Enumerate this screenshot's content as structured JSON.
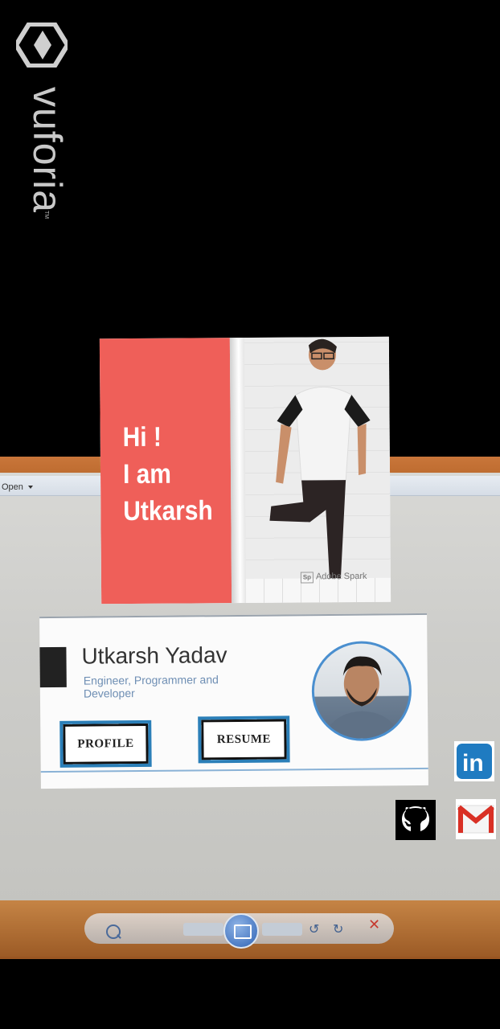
{
  "watermark": {
    "brand": "vuforia",
    "trademark": "TM"
  },
  "background_viewer": {
    "menu_label": "Open"
  },
  "intro_card": {
    "greeting_lines": [
      "Hi !",
      "I am",
      "Utkarsh"
    ],
    "watermark_badge": "Sp",
    "watermark_text": "Adobe Spark"
  },
  "profile_card": {
    "name": "Utkarsh Yadav",
    "subtitle": "Engineer, Programmer and Developer",
    "profile_button": "PROFILE",
    "resume_button": "RESUME"
  },
  "social": {
    "linkedin": "in",
    "icons": [
      "linkedin-icon",
      "github-icon",
      "gmail-icon"
    ]
  },
  "colors": {
    "accent_red": "#ef5f59",
    "button_border": "#2b7fb8",
    "avatar_ring": "#4a8fcf",
    "linkedin": "#1f7bc1"
  }
}
